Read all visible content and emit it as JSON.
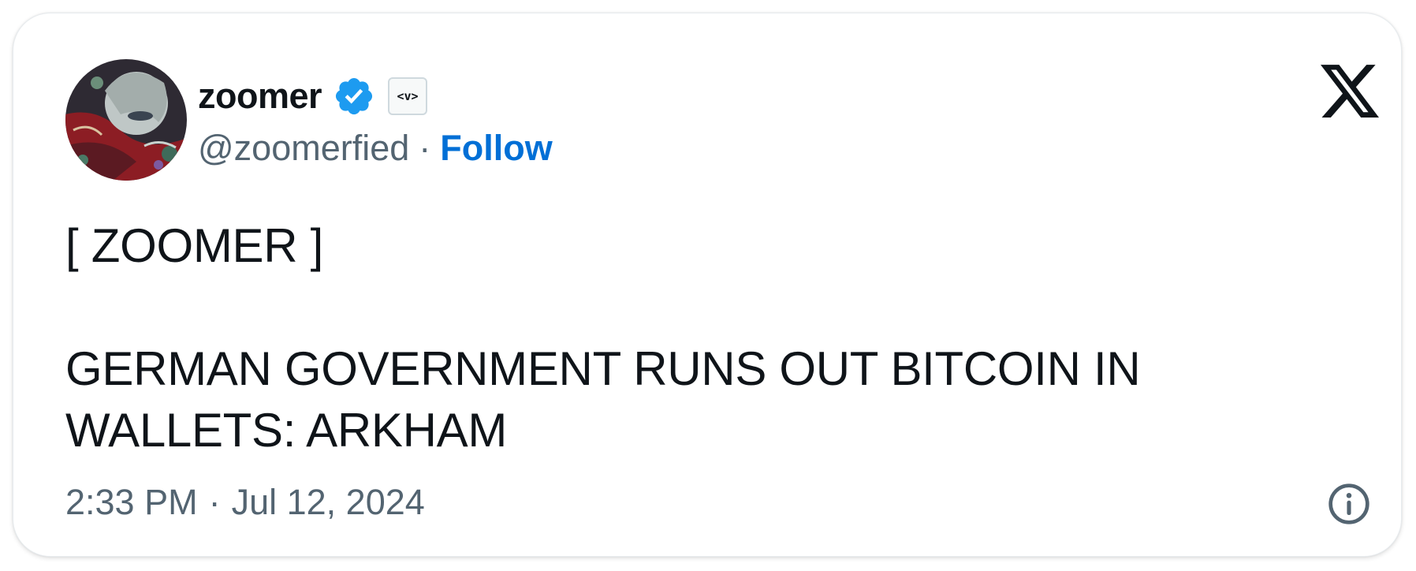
{
  "tweet": {
    "author": {
      "display_name": "zoomer",
      "handle": "@zoomerfied",
      "follow_label": "Follow",
      "affiliate_badge_text": "<v>",
      "verified": true
    },
    "text_line_1": "[ ZOOMER ]",
    "text_line_2": "GERMAN GOVERNMENT RUNS OUT BITCOIN IN",
    "text_line_3": "WALLETS: ARKHAM",
    "time": "2:33 PM",
    "date": "Jul 12, 2024",
    "separator": "·"
  },
  "icons": {
    "verified": "verified-badge-icon",
    "platform": "x-logo-icon",
    "info": "info-icon"
  },
  "colors": {
    "text_primary": "#0f1419",
    "text_secondary": "#536471",
    "link": "#006fd6",
    "verified_blue": "#1d9bf0"
  }
}
